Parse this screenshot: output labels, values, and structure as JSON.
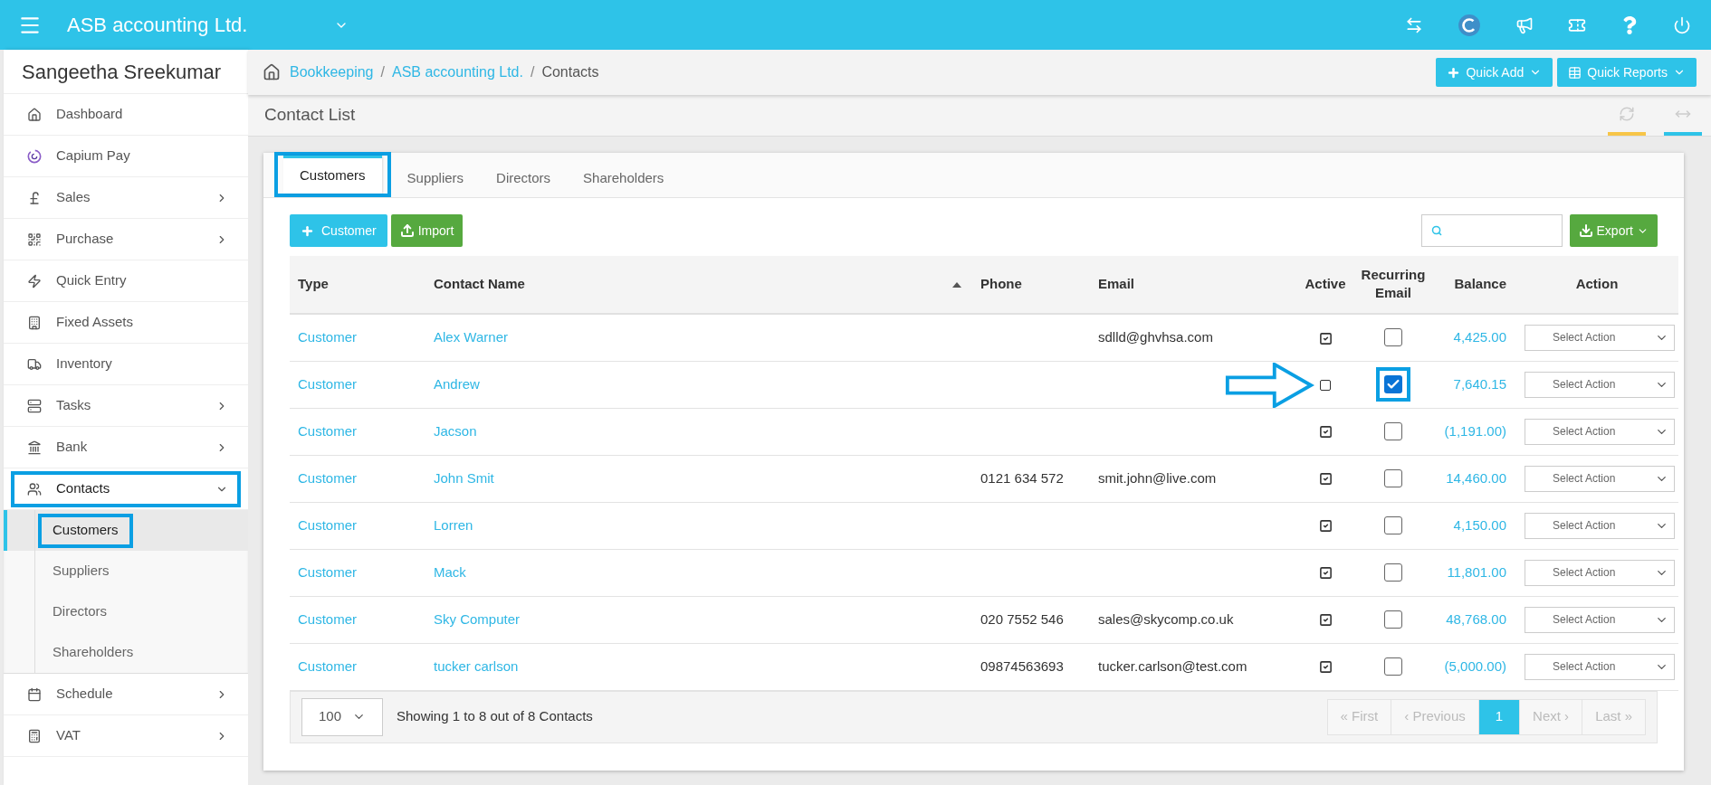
{
  "top_bar": {
    "company": "ASB accounting Ltd."
  },
  "sidebar": {
    "user": "Sangeetha Sreekumar",
    "items": [
      {
        "label": "Dashboard",
        "kind": "link",
        "annotated": false
      },
      {
        "label": "Capium Pay",
        "kind": "link",
        "annotated": false
      },
      {
        "label": "Sales",
        "kind": "menu",
        "expanded": false,
        "annotated": false
      },
      {
        "label": "Purchase",
        "kind": "menu",
        "expanded": false,
        "annotated": false
      },
      {
        "label": "Quick Entry",
        "kind": "link",
        "annotated": false
      },
      {
        "label": "Fixed Assets",
        "kind": "link",
        "annotated": false
      },
      {
        "label": "Inventory",
        "kind": "link",
        "annotated": false
      },
      {
        "label": "Tasks",
        "kind": "menu",
        "expanded": false,
        "annotated": false
      },
      {
        "label": "Bank",
        "kind": "menu",
        "expanded": false,
        "annotated": false
      },
      {
        "label": "Contacts",
        "kind": "menu",
        "expanded": true,
        "annotated": true,
        "children": [
          {
            "label": "Customers",
            "selected": true,
            "annotated": true
          },
          {
            "label": "Suppliers",
            "selected": false,
            "annotated": false
          },
          {
            "label": "Directors",
            "selected": false,
            "annotated": false
          },
          {
            "label": "Shareholders",
            "selected": false,
            "annotated": false
          }
        ]
      },
      {
        "label": "Schedule",
        "kind": "menu",
        "expanded": false,
        "annotated": false
      },
      {
        "label": "VAT",
        "kind": "menu",
        "expanded": false,
        "annotated": false
      }
    ]
  },
  "breadcrumb": {
    "separator": "/",
    "items": [
      {
        "label": "Bookkeeping",
        "link": true
      },
      {
        "label": "ASB accounting Ltd.",
        "link": true
      },
      {
        "label": "Contacts",
        "link": false
      }
    ]
  },
  "header_buttons": [
    "Quick Add",
    "Quick Reports"
  ],
  "page_title": "Contact List",
  "tabs": [
    {
      "label": "Customers",
      "selected": true,
      "annotated": true
    },
    {
      "label": "Suppliers",
      "selected": false,
      "annotated": false
    },
    {
      "label": "Directors",
      "selected": false,
      "annotated": false
    },
    {
      "label": "Shareholders",
      "selected": false,
      "annotated": false
    }
  ],
  "toolbar": {
    "add_button": "Customer",
    "import_button": "Import",
    "export_button": "Export"
  },
  "table": {
    "columns": [
      "Type",
      "Contact Name",
      "Phone",
      "Email",
      "Active",
      "Recurring Email",
      "Balance",
      "Action"
    ],
    "rows": [
      {
        "type": "Customer",
        "name": "Alex Warner",
        "phone": "",
        "email": "sdlld@ghvhsa.com",
        "active": true,
        "recurring_email": false,
        "balance": "4,425.00",
        "action": "Select Action",
        "annotated": false
      },
      {
        "type": "Customer",
        "name": "Andrew",
        "phone": "",
        "email": "",
        "active": false,
        "recurring_email": true,
        "balance": "7,640.15",
        "action": "Select Action",
        "annotated": true
      },
      {
        "type": "Customer",
        "name": "Jacson",
        "phone": "",
        "email": "",
        "active": true,
        "recurring_email": false,
        "balance": "(1,191.00)",
        "action": "Select Action",
        "annotated": false
      },
      {
        "type": "Customer",
        "name": "John Smit",
        "phone": "0121 634 572",
        "email": "smit.john@live.com",
        "active": true,
        "recurring_email": false,
        "balance": "14,460.00",
        "action": "Select Action",
        "annotated": false
      },
      {
        "type": "Customer",
        "name": "Lorren",
        "phone": "",
        "email": "",
        "active": true,
        "recurring_email": false,
        "balance": "4,150.00",
        "action": "Select Action",
        "annotated": false
      },
      {
        "type": "Customer",
        "name": "Mack",
        "phone": "",
        "email": "",
        "active": true,
        "recurring_email": false,
        "balance": "11,801.00",
        "action": "Select Action",
        "annotated": false
      },
      {
        "type": "Customer",
        "name": "Sky Computer",
        "phone": "020 7552 546",
        "email": "sales@skycomp.co.uk",
        "active": true,
        "recurring_email": false,
        "balance": "48,768.00",
        "action": "Select Action",
        "annotated": false
      },
      {
        "type": "Customer",
        "name": "tucker carlson",
        "phone": "09874563693",
        "email": "tucker.carlson@test.com",
        "active": true,
        "recurring_email": false,
        "balance": "(5,000.00)",
        "action": "Select Action",
        "annotated": false
      }
    ]
  },
  "footer": {
    "page_size": "100",
    "summary": "Showing 1 to 8 out of 8 Contacts",
    "pagination": [
      {
        "label": "« First",
        "selected": false
      },
      {
        "label": "‹ Previous",
        "selected": false
      },
      {
        "label": "1",
        "selected": true
      },
      {
        "label": "Next ›",
        "selected": false
      },
      {
        "label": "Last »",
        "selected": false
      }
    ]
  }
}
